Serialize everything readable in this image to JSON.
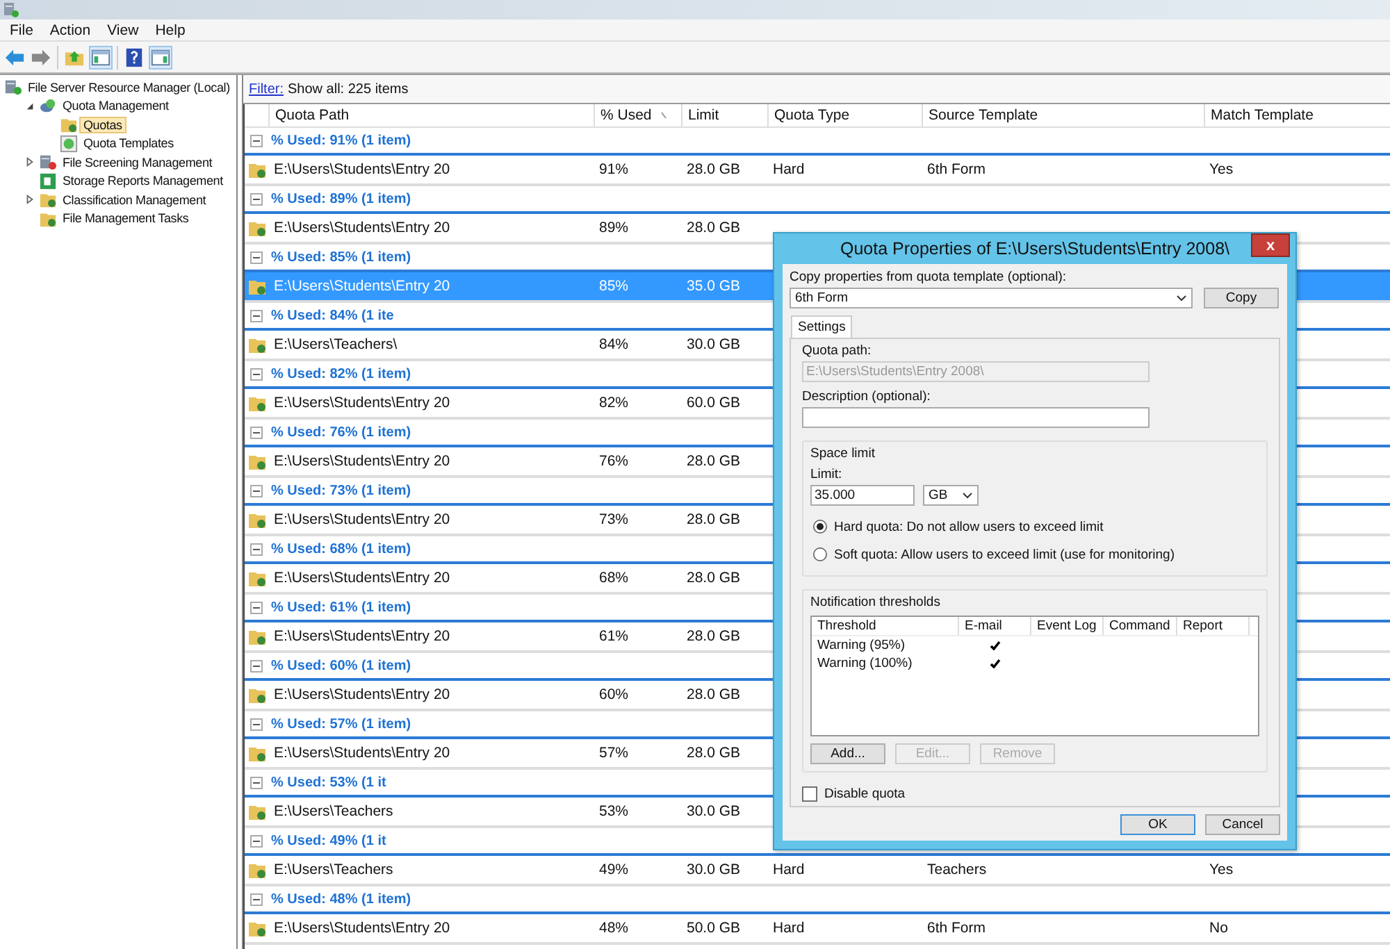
{
  "menu": [
    "File",
    "Action",
    "View",
    "Help"
  ],
  "tree": [
    {
      "label": "File Server Resource Manager (Local)",
      "selected": false,
      "children": [
        {
          "label": "Quota Management",
          "expanded": true,
          "selected": false,
          "children": [
            {
              "label": "Quotas",
              "selected": true
            },
            {
              "label": "Quota Templates",
              "selected": false
            }
          ]
        },
        {
          "label": "File Screening Management",
          "expanded": false,
          "selected": false
        },
        {
          "label": "Storage Reports Management",
          "selected": false
        },
        {
          "label": "Classification Management",
          "expanded": false,
          "selected": false
        },
        {
          "label": "File Management Tasks",
          "selected": false
        }
      ]
    }
  ],
  "filter": {
    "link": "Filter:",
    "text": "Show all: 225 items"
  },
  "columns": [
    {
      "label": "Quota Path",
      "sorted": false
    },
    {
      "label": "% Used",
      "sorted": true
    },
    {
      "label": "Limit",
      "sorted": false
    },
    {
      "label": "Quota Type",
      "sorted": false
    },
    {
      "label": "Source Template",
      "sorted": false
    },
    {
      "label": "Match Template",
      "sorted": false
    }
  ],
  "groups": [
    {
      "header": "% Used: 91% (1 item)",
      "row": {
        "path": "E:\\Users\\Students\\Entry 20",
        "used": "91%",
        "limit": "28.0 GB",
        "type": "Hard",
        "template": "6th Form",
        "match": "Yes"
      },
      "selected": false
    },
    {
      "header": "% Used: 89% (1 item)",
      "row": {
        "path": "E:\\Users\\Students\\Entry 20",
        "used": "89%",
        "limit": "28.0 GB"
      },
      "selected": false
    },
    {
      "header": "% Used: 85% (1 item)",
      "row": {
        "path": "E:\\Users\\Students\\Entry 20",
        "used": "85%",
        "limit": "35.0 GB"
      },
      "selected": true
    },
    {
      "header": "% Used: 84% (1 ite",
      "row": {
        "path": "E:\\Users\\Teachers\\",
        "used": "84%",
        "limit": "30.0 GB"
      },
      "selected": false
    },
    {
      "header": "% Used: 82% (1 item)",
      "row": {
        "path": "E:\\Users\\Students\\Entry 20",
        "used": "82%",
        "limit": "60.0 GB"
      },
      "selected": false
    },
    {
      "header": "% Used: 76% (1 item)",
      "row": {
        "path": "E:\\Users\\Students\\Entry 20",
        "used": "76%",
        "limit": "28.0 GB"
      },
      "selected": false
    },
    {
      "header": "% Used: 73% (1 item)",
      "row": {
        "path": "E:\\Users\\Students\\Entry 20",
        "used": "73%",
        "limit": "28.0 GB"
      },
      "selected": false
    },
    {
      "header": "% Used: 68% (1 item)",
      "row": {
        "path": "E:\\Users\\Students\\Entry 20",
        "used": "68%",
        "limit": "28.0 GB"
      },
      "selected": false
    },
    {
      "header": "% Used: 61% (1 item)",
      "row": {
        "path": "E:\\Users\\Students\\Entry 20",
        "used": "61%",
        "limit": "28.0 GB"
      },
      "selected": false
    },
    {
      "header": "% Used: 60% (1 item)",
      "row": {
        "path": "E:\\Users\\Students\\Entry 20",
        "used": "60%",
        "limit": "28.0 GB"
      },
      "selected": false
    },
    {
      "header": "% Used: 57% (1 item)",
      "row": {
        "path": "E:\\Users\\Students\\Entry 20",
        "used": "57%",
        "limit": "28.0 GB"
      },
      "selected": false
    },
    {
      "header": "% Used: 53% (1 it",
      "row": {
        "path": "E:\\Users\\Teachers",
        "used": "53%",
        "limit": "30.0 GB"
      },
      "selected": false
    },
    {
      "header": "% Used: 49% (1 it",
      "row": {
        "path": "E:\\Users\\Teachers",
        "used": "49%",
        "limit": "30.0 GB",
        "type": "Hard",
        "template": "Teachers",
        "match": "Yes"
      },
      "selected": false
    },
    {
      "header": "% Used: 48% (1 item)",
      "row": {
        "path": "E:\\Users\\Students\\Entry 20",
        "used": "48%",
        "limit": "50.0 GB",
        "type": "Hard",
        "template": "6th Form",
        "match": "No"
      },
      "selected": false
    }
  ],
  "dialog": {
    "title": "Quota Properties of E:\\Users\\Students\\Entry 2008\\",
    "close": "x",
    "copy_label": "Copy properties from quota template (optional):",
    "template": "6th Form",
    "copy_button": "Copy",
    "tabs": [
      {
        "label": "Settings",
        "selected": true
      }
    ],
    "quota_path_label": "Quota path:",
    "quota_path": "E:\\Users\\Students\\Entry 2008\\",
    "description_label": "Description (optional):",
    "space_limit": {
      "legend": "Space limit",
      "limit_label": "Limit:",
      "limit": "35.000",
      "unit": "GB",
      "options": [
        {
          "label": "Hard quota: Do not allow users to exceed limit",
          "selected": true
        },
        {
          "label": "Soft quota: Allow users to exceed limit (use for monitoring)",
          "selected": false
        }
      ]
    },
    "notifications": {
      "legend": "Notification thresholds",
      "columns": [
        "Threshold",
        "E-mail",
        "Event Log",
        "Command",
        "Report"
      ],
      "rows": [
        {
          "threshold": "Warning (95%)",
          "email": true
        },
        {
          "threshold": "Warning (100%)",
          "email": true
        }
      ],
      "buttons": [
        {
          "label": "Add...",
          "disabled": false
        },
        {
          "label": "Edit...",
          "disabled": true
        },
        {
          "label": "Remove",
          "disabled": true
        }
      ]
    },
    "disable_quota": {
      "label": "Disable quota",
      "checked": false
    },
    "footer": [
      {
        "label": "OK",
        "default": true
      },
      {
        "label": "Cancel",
        "default": false
      }
    ]
  }
}
